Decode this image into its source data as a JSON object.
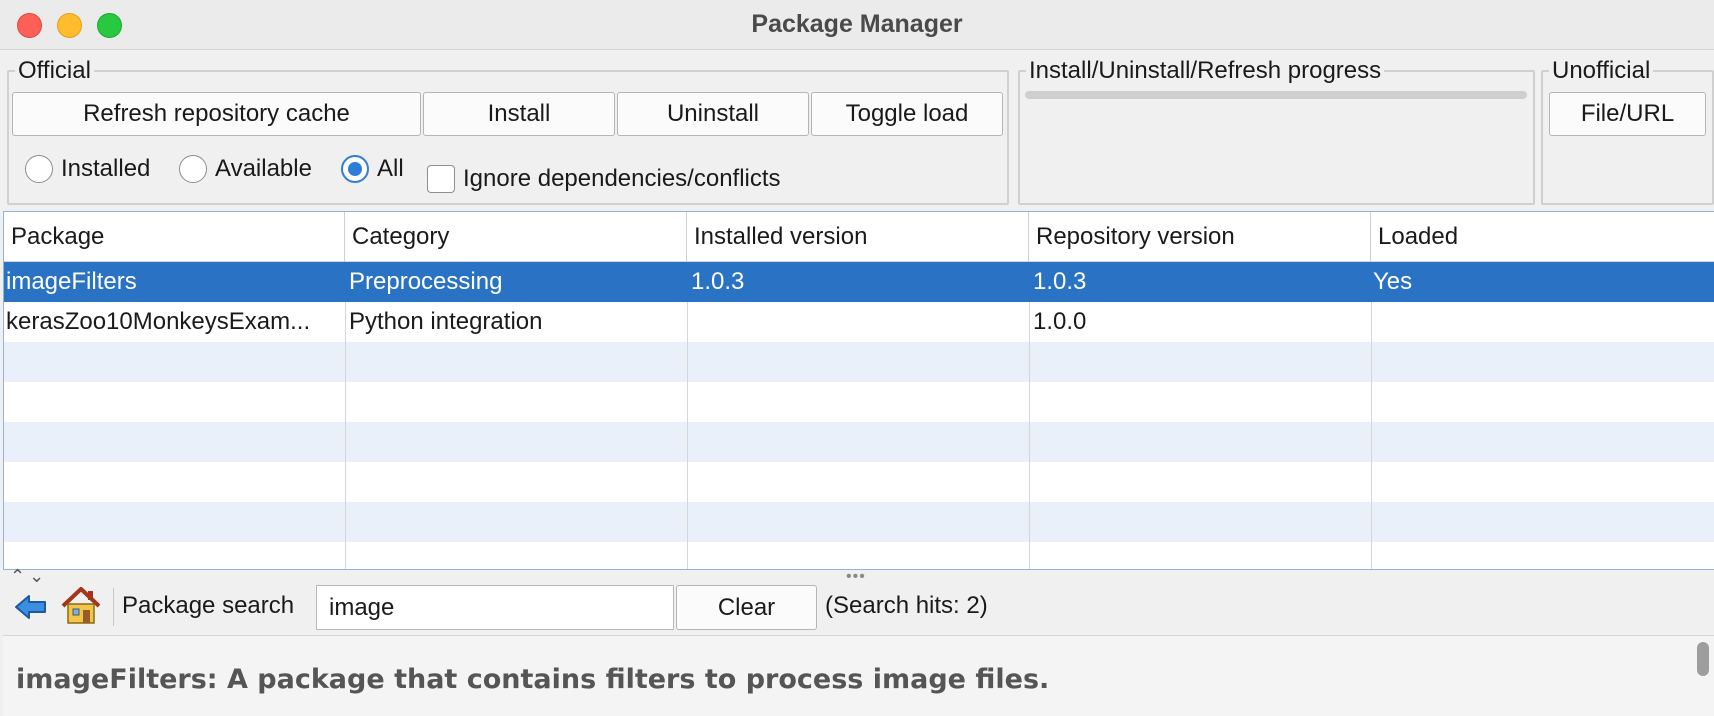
{
  "window": {
    "title": "Package Manager"
  },
  "official": {
    "legend": "Official",
    "buttons": {
      "refresh": "Refresh repository cache",
      "install": "Install",
      "uninstall": "Uninstall",
      "toggle_load": "Toggle load"
    },
    "filter": {
      "installed": "Installed",
      "available": "Available",
      "all": "All",
      "selected": "All"
    },
    "ignore_dependencies": {
      "label": "Ignore dependencies/conflicts",
      "checked": false
    }
  },
  "progress": {
    "legend": "Install/Uninstall/Refresh progress",
    "value": 0
  },
  "unofficial": {
    "legend": "Unofficial",
    "file_url": "File/URL"
  },
  "table": {
    "headers": [
      "Package",
      "Category",
      "Installed version",
      "Repository version",
      "Loaded"
    ],
    "rows": [
      [
        "imageFilters",
        "Preprocessing",
        "1.0.3",
        "1.0.3",
        "Yes"
      ],
      [
        "kerasZoo10MonkeysExam...",
        "Python integration",
        "",
        "1.0.0",
        ""
      ]
    ],
    "selected_row": 0
  },
  "search": {
    "label": "Package search",
    "value": "image",
    "clear": "Clear",
    "hits": "(Search hits: 2)"
  },
  "description": "imageFilters: A package that contains filters to process image files.",
  "icons": {
    "back": "back-arrow-icon",
    "home": "home-icon"
  },
  "colors": {
    "selection": "#2a72c4",
    "radio_accent": "#2d7fd6",
    "alt_row": "#e9f0fa"
  }
}
